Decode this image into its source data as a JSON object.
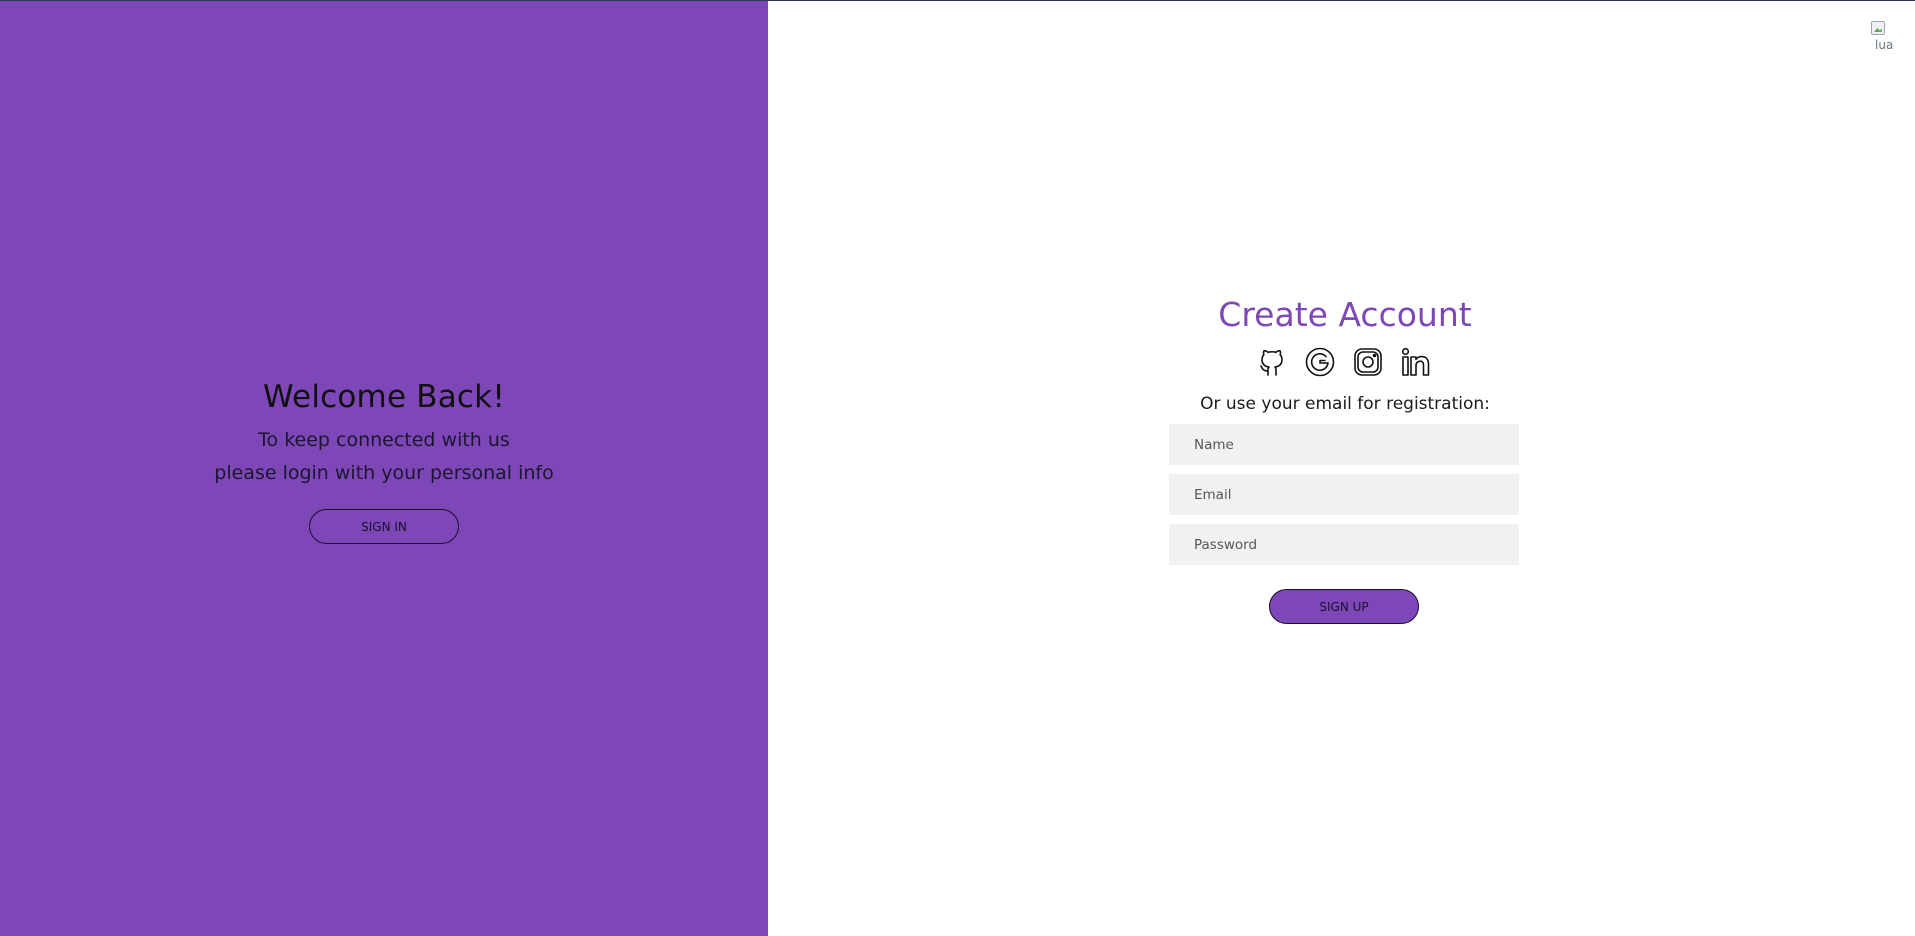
{
  "colors": {
    "accent": "#7e47b7",
    "input_background": "#f2f1f2",
    "dark_text": "#101010"
  },
  "left_panel": {
    "title": "Welcome Back!",
    "line1": "To keep connected with us",
    "line2": "please login with your personal info",
    "sign_in_label": "SIGN IN"
  },
  "header": {
    "broken_image_alt": "lua"
  },
  "signup_form": {
    "title": "Create Account",
    "social_icons": [
      "github-icon",
      "google-icon",
      "instagram-icon",
      "linkedin-icon"
    ],
    "subtitle": "Or use your email for registration:",
    "name_placeholder": "Name",
    "email_placeholder": "Email",
    "password_placeholder": "Password",
    "sign_up_label": "SIGN UP"
  }
}
